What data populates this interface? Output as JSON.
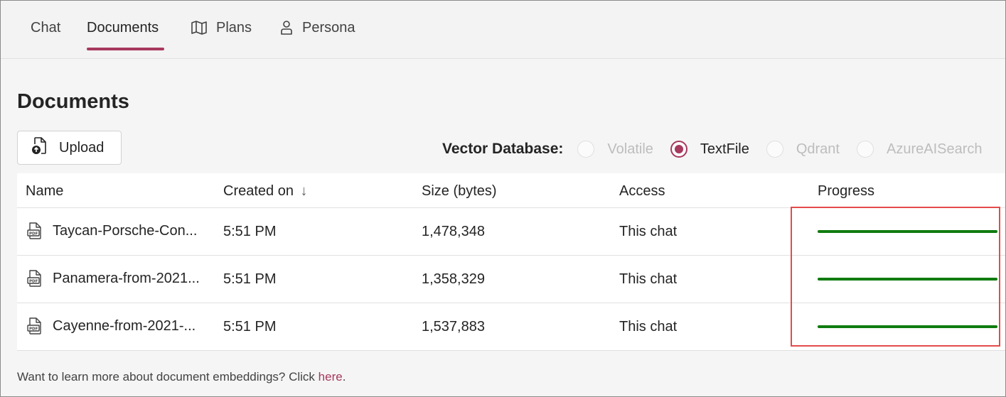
{
  "tabs": [
    {
      "label": "Chat",
      "icon": "none"
    },
    {
      "label": "Documents",
      "icon": "none",
      "selected": true
    },
    {
      "label": "Plans",
      "icon": "map-icon"
    },
    {
      "label": "Persona",
      "icon": "person-icon"
    }
  ],
  "page": {
    "title": "Documents"
  },
  "upload": {
    "label": "Upload",
    "icon": "document-upload-icon"
  },
  "vector_database": {
    "label": "Vector Database:",
    "options": [
      {
        "label": "Volatile",
        "checked": false,
        "disabled": true
      },
      {
        "label": "TextFile",
        "checked": true,
        "disabled": false
      },
      {
        "label": "Qdrant",
        "checked": false,
        "disabled": true
      },
      {
        "label": "AzureAISearch",
        "checked": false,
        "disabled": true
      }
    ]
  },
  "table": {
    "columns": [
      "Name",
      "Created on",
      "Size (bytes)",
      "Access",
      "Progress"
    ],
    "sort_indicator": "↓",
    "rows": [
      {
        "name": "Taycan-Porsche-Con...",
        "created": "5:51 PM",
        "size": "1,478,348",
        "access": "This chat",
        "progress": 1.0
      },
      {
        "name": "Panamera-from-2021...",
        "created": "5:51 PM",
        "size": "1,358,329",
        "access": "This chat",
        "progress": 1.0
      },
      {
        "name": "Cayenne-from-2021-...",
        "created": "5:51 PM",
        "size": "1,537,883",
        "access": "This chat",
        "progress": 1.0
      }
    ]
  },
  "footer": {
    "text": "Want to learn more about document embeddings? Click ",
    "link": "here",
    "suffix": "."
  },
  "colors": {
    "accent": "#a7385e",
    "progress": "#107c10",
    "highlight": "#e34b4b"
  }
}
